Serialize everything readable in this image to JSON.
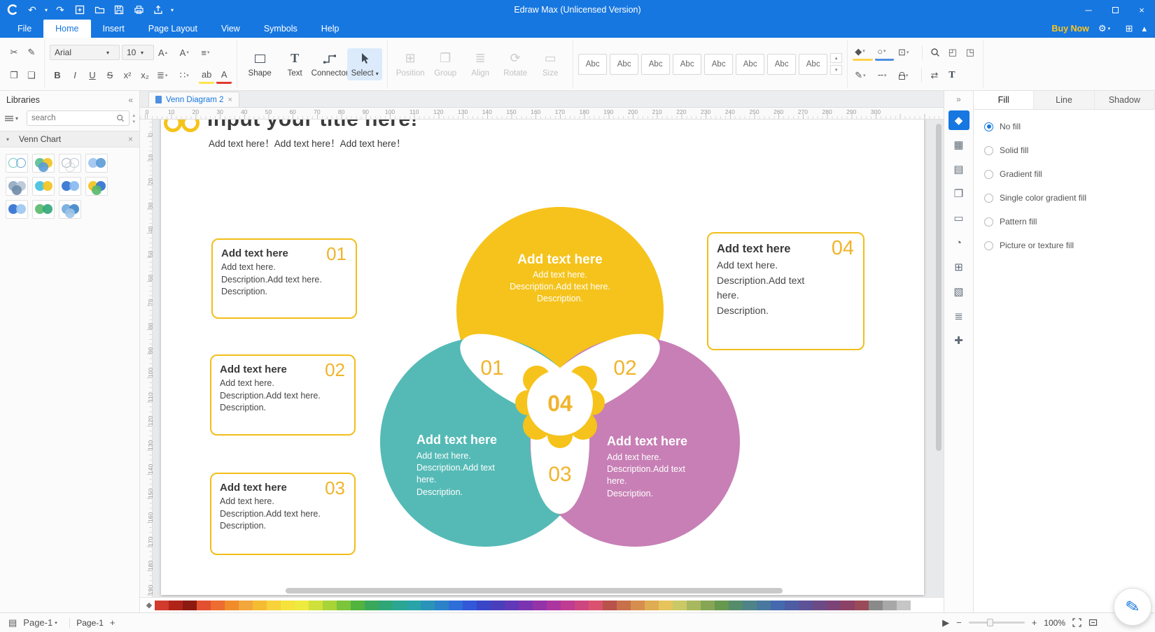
{
  "colors": {
    "accent": "#1777E0",
    "yellow": "#F5C31B",
    "teal": "#55BAB6",
    "purple": "#C77FB5",
    "gold": "#F0B42C"
  },
  "icons": {
    "undo": "↶",
    "redo": "↷",
    "dropdown": "▾",
    "up": "▴",
    "collapse": "«",
    "close": "×",
    "minimize": "─",
    "scissors": "✂",
    "brush": "✎",
    "copy": "❐",
    "paste": "❏",
    "align": "≡",
    "spacing": "≣",
    "list": "∷",
    "letterA": "A",
    "text_tool": "T",
    "gear": "⚙",
    "appgrid": "⊞",
    "chevron_up": "▴",
    "fill_bucket": "◆",
    "outline_circle": "○",
    "crop": "⊡",
    "front": "◰",
    "back": "◳",
    "pen": "✎",
    "dash": "╌",
    "swap": "⇄",
    "play": "▶",
    "minus": "−",
    "plus": "+",
    "pageview": "▤",
    "palette_bucket": "◆"
  },
  "titlebar": {
    "title": "Edraw Max (Unlicensed Version)"
  },
  "menubar": {
    "tabs": [
      "File",
      "Home",
      "Insert",
      "Page Layout",
      "View",
      "Symbols",
      "Help"
    ],
    "active_index": 1,
    "buy_now": "Buy Now"
  },
  "ribbon": {
    "font_name": "Arial",
    "font_size": "10",
    "bold": "B",
    "italic": "I",
    "underline": "U",
    "strike": "S",
    "sup": "x²",
    "sub": "x₂",
    "highlight": "ab",
    "font_color": "A",
    "tools": [
      {
        "label": "Shape"
      },
      {
        "label": "Text"
      },
      {
        "label": "Connector"
      },
      {
        "label": "Select",
        "active": true
      }
    ],
    "arrange": [
      {
        "label": "Position",
        "glyph": "⊞"
      },
      {
        "label": "Group",
        "glyph": "❐"
      },
      {
        "label": "Align",
        "glyph": "≣"
      },
      {
        "label": "Rotate",
        "glyph": "⟳"
      },
      {
        "label": "Size",
        "glyph": "▭"
      }
    ],
    "style_gallery": {
      "item_label": "Abc",
      "count": 8
    }
  },
  "libraries": {
    "title": "Libraries",
    "search_placeholder": "search",
    "section": "Venn Chart",
    "thumbs": [
      {
        "c1": "#63C2B8",
        "c2": "#5A9BD5",
        "outline": true
      },
      {
        "c1": "#58BE8E",
        "c2": "#F3C21D",
        "c3": "#5A9BD5"
      },
      {
        "c1": "#9AA7B4",
        "c2": "#B8C2CC",
        "c3": "#CFD6DD",
        "outline": true
      },
      {
        "c1": "#9DC3EF",
        "c2": "#5A9BD5"
      },
      {
        "c1": "#8FA8C0",
        "c2": "#B7C6D6",
        "c3": "#6E8BA8"
      },
      {
        "c1": "#3FC0DE",
        "c2": "#F3C21D"
      },
      {
        "c1": "#2E6FD0",
        "c2": "#85B8F0"
      },
      {
        "c1": "#F3C21D",
        "c2": "#2E6FD0",
        "c3": "#57B96A"
      },
      {
        "c1": "#2E6FD0",
        "c2": "#9CC7F2"
      },
      {
        "c1": "#57B96A",
        "c2": "#2FA678"
      },
      {
        "c1": "#6FA8DC",
        "c2": "#3D85C8",
        "c3": "#9FC5E8"
      }
    ]
  },
  "doc": {
    "tab": "Venn Diagram 2"
  },
  "ruler": {
    "h_max": 300,
    "v_max": 190,
    "step": 10
  },
  "canvas": {
    "title": "Input your title here!",
    "subtitle": "Add text here！Add text here！Add text here！",
    "venn": {
      "labels": [
        "01",
        "02",
        "03",
        "04"
      ],
      "top": {
        "heading": "Add text here",
        "lines": [
          "Add text here.",
          "Description.Add text here.",
          "Description."
        ]
      },
      "left": {
        "heading": "Add text here",
        "lines": [
          "Add text here.",
          "Description.Add text",
          "here.",
          "Description."
        ]
      },
      "right": {
        "heading": "Add text here",
        "lines": [
          "Add text here.",
          "Description.Add text",
          "here.",
          "Description."
        ]
      }
    },
    "callouts": [
      {
        "number": "01",
        "heading": "Add text here",
        "lines": [
          "Add text here.",
          "Description.Add text here.",
          "Description."
        ]
      },
      {
        "number": "02",
        "heading": "Add text here",
        "lines": [
          "Add text here.",
          "Description.Add text here.",
          "Description."
        ]
      },
      {
        "number": "03",
        "heading": "Add text here",
        "lines": [
          "Add text here.",
          "Description.Add text here.",
          "Description."
        ]
      },
      {
        "number": "04",
        "heading": "Add text here",
        "lines": [
          "Add text here.",
          "Description.Add text",
          "here.",
          "Description."
        ]
      }
    ]
  },
  "right_strip": [
    {
      "name": "expand-panel-icon",
      "glyph": "»"
    },
    {
      "name": "fill-tool-icon",
      "glyph": "◆",
      "active": true
    },
    {
      "name": "symbol-library-icon",
      "glyph": "▦"
    },
    {
      "name": "insert-picture-icon",
      "glyph": "▤"
    },
    {
      "name": "layers-icon",
      "glyph": "❐"
    },
    {
      "name": "note-icon",
      "glyph": "▭"
    },
    {
      "name": "chart-icon",
      "glyph": "◔"
    },
    {
      "name": "table-icon",
      "glyph": "⊞"
    },
    {
      "name": "floorplan-icon",
      "glyph": "▧"
    },
    {
      "name": "outline-icon",
      "glyph": "≣"
    },
    {
      "name": "transform-icon",
      "glyph": "✚"
    }
  ],
  "right_panel": {
    "tabs": [
      "Fill",
      "Line",
      "Shadow"
    ],
    "active_index": 0,
    "options": [
      {
        "label": "No fill",
        "selected": true
      },
      {
        "label": "Solid fill"
      },
      {
        "label": "Gradient fill"
      },
      {
        "label": "Single color gradient fill"
      },
      {
        "label": "Pattern fill"
      },
      {
        "label": "Picture or texture fill"
      }
    ]
  },
  "statusbar": {
    "page_nav": "Page-1",
    "page_tab": "Page-1",
    "add_page": "+",
    "zoom": "100%"
  },
  "palette": [
    "#D23A2E",
    "#B02318",
    "#8C1A10",
    "#E2502F",
    "#ED6C2F",
    "#F08C2A",
    "#F2A63B",
    "#F5BC31",
    "#F7D23A",
    "#F5E33C",
    "#EDEB3E",
    "#CFE03A",
    "#A8D438",
    "#7BC43B",
    "#52B43E",
    "#3AA85C",
    "#2FA678",
    "#2AA693",
    "#28A4A8",
    "#2A93B8",
    "#2C82C8",
    "#2E6ED8",
    "#3158D8",
    "#3946C8",
    "#4A3EBB",
    "#6038B8",
    "#7A34B0",
    "#9432A8",
    "#AC36A0",
    "#C03C92",
    "#CE4680",
    "#DA5270",
    "#B8524A",
    "#C8704A",
    "#D68E4E",
    "#DFAC54",
    "#E5C45C",
    "#CBC866",
    "#A8B85E",
    "#86A656",
    "#679850",
    "#558C6C",
    "#4E8488",
    "#48789E",
    "#4668AE",
    "#4E5CA4",
    "#5C5296",
    "#6C4A86",
    "#7C4476",
    "#8C4266",
    "#9A4A58",
    "#8A8A8A",
    "#A8A8A8",
    "#C6C6C6"
  ]
}
